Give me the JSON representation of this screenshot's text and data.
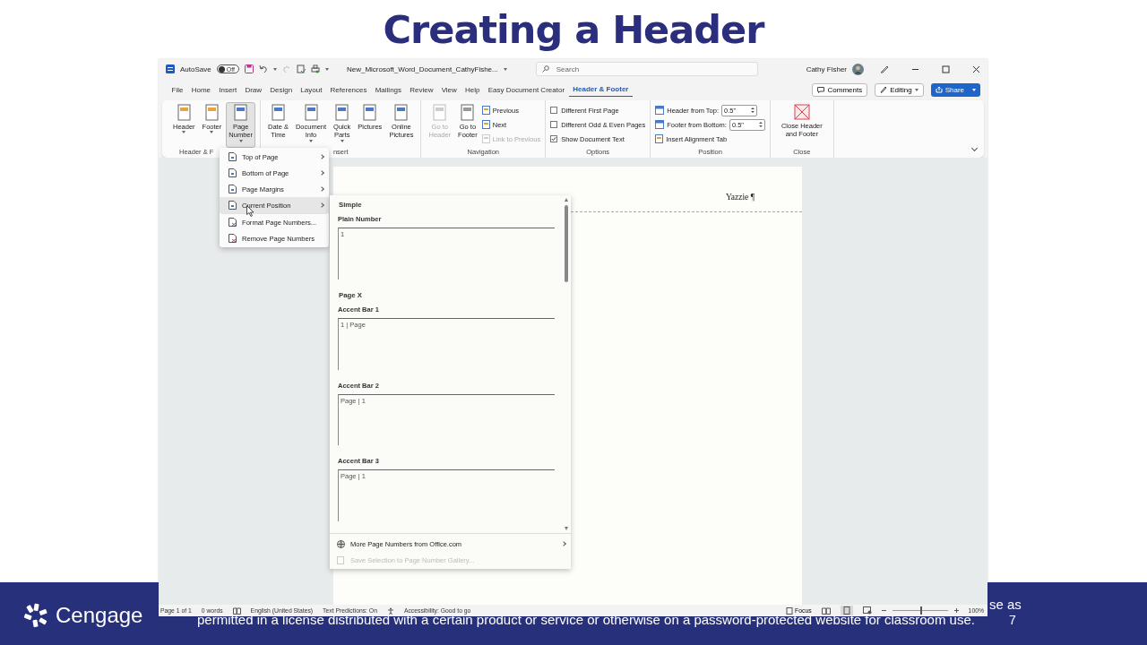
{
  "slide": {
    "title": "Creating a Header",
    "logo": "Cengage",
    "footer_line_1": "se as",
    "footer_line_2": "permitted in a license distributed with a certain product or service or otherwise on a password-protected website for classroom use.",
    "page_number": "7"
  },
  "window": {
    "autosave_label": "AutoSave",
    "autosave": {
      "label": "Off",
      "on": false
    },
    "filename": "New_Microsoft_Word_Document_CathyFishe...",
    "search": {
      "placeholder": "Search"
    },
    "user": "Cathy Fisher"
  },
  "tabs": [
    {
      "label": "File",
      "selected": false
    },
    {
      "label": "Home",
      "selected": false
    },
    {
      "label": "Insert",
      "selected": false
    },
    {
      "label": "Draw",
      "selected": false
    },
    {
      "label": "Design",
      "selected": false
    },
    {
      "label": "Layout",
      "selected": false
    },
    {
      "label": "References",
      "selected": false
    },
    {
      "label": "Mailings",
      "selected": false
    },
    {
      "label": "Review",
      "selected": false
    },
    {
      "label": "View",
      "selected": false
    },
    {
      "label": "Help",
      "selected": false
    },
    {
      "label": "Easy Document Creator",
      "selected": false
    },
    {
      "label": "Header & Footer",
      "selected": true
    }
  ],
  "actions": {
    "comments": "Comments",
    "editing": "Editing",
    "share": "Share"
  },
  "ribbon": [
    {
      "label": "Header & F",
      "items": [
        {
          "kind": "large",
          "label": "Header",
          "dropdown": true,
          "pressed": false,
          "disabled": false
        },
        {
          "kind": "large",
          "label": "Footer",
          "dropdown": true,
          "pressed": false,
          "disabled": false
        },
        {
          "kind": "large",
          "label": "Page\nNumber",
          "dropdown": true,
          "pressed": true,
          "disabled": false
        }
      ]
    },
    {
      "label": "nsert",
      "items": [
        {
          "kind": "large",
          "label": "Date &\nTime",
          "dropdown": false,
          "pressed": false,
          "disabled": false
        },
        {
          "kind": "large",
          "label": "Document\nInfo",
          "dropdown": true,
          "pressed": false,
          "disabled": false
        },
        {
          "kind": "large",
          "label": "Quick\nParts",
          "dropdown": true,
          "pressed": false,
          "disabled": false
        },
        {
          "kind": "large",
          "label": "Pictures",
          "dropdown": false,
          "pressed": false,
          "disabled": false
        },
        {
          "kind": "large",
          "label": "Online\nPictures",
          "dropdown": false,
          "pressed": false,
          "disabled": false
        }
      ]
    },
    {
      "label": "Navigation",
      "items": [
        {
          "kind": "large",
          "label": "Go to\nHeader",
          "dropdown": false,
          "pressed": false,
          "disabled": true
        },
        {
          "kind": "large",
          "label": "Go to\nFooter",
          "dropdown": false,
          "pressed": false,
          "disabled": false
        },
        {
          "kind": "stack",
          "children": [
            {
              "kind": "small",
              "label": "Previous",
              "disabled": false
            },
            {
              "kind": "small",
              "label": "Next",
              "disabled": false
            },
            {
              "kind": "small",
              "label": "Link to Previous",
              "disabled": true
            }
          ]
        }
      ]
    },
    {
      "label": "Options",
      "items": [
        {
          "kind": "stack",
          "children": [
            {
              "kind": "checkbox",
              "label": "Different First Page",
              "checked": false
            },
            {
              "kind": "checkbox",
              "label": "Different Odd & Even Pages",
              "checked": false
            },
            {
              "kind": "checkbox",
              "label": "Show Document Text",
              "checked": true
            }
          ]
        }
      ]
    },
    {
      "label": "Position",
      "items": [
        {
          "kind": "stack",
          "children": [
            {
              "kind": "spinner",
              "label": "Header from Top:",
              "value": "0.5\""
            },
            {
              "kind": "spinner",
              "label": "Footer from Bottom:",
              "value": "0.5\""
            },
            {
              "kind": "small",
              "label": "Insert Alignment Tab",
              "disabled": false
            }
          ]
        }
      ]
    },
    {
      "label": "Close",
      "items": [
        {
          "kind": "close",
          "label": "Close Header\nand Footer"
        }
      ]
    }
  ],
  "document": {
    "header_text": "Yazzie ¶"
  },
  "menu": [
    {
      "label": "Top of Page",
      "kind": "submenu",
      "selected": false
    },
    {
      "label": "Bottom of Page",
      "kind": "submenu",
      "selected": false
    },
    {
      "label": "Page Margins",
      "kind": "submenu",
      "selected": false
    },
    {
      "label": "Current Position",
      "kind": "submenu",
      "selected": true
    },
    {
      "label": "Format Page Numbers...",
      "kind": "command",
      "selected": false
    },
    {
      "label": "Remove Page Numbers",
      "kind": "command",
      "selected": false
    }
  ],
  "gallery": {
    "sections": [
      {
        "heading": "Simple",
        "items": [
          {
            "label": "Plain Number",
            "preview": "1"
          }
        ]
      },
      {
        "heading": "Page X",
        "items": [
          {
            "label": "Accent Bar 1",
            "preview": "1 | Page"
          },
          {
            "label": "Accent Bar 2",
            "preview": "Page | 1"
          },
          {
            "label": "Accent Bar 3",
            "preview": "Page | 1"
          }
        ]
      }
    ],
    "footer": [
      {
        "label": "More Page Numbers from Office.com",
        "disabled": false
      },
      {
        "label": "Save Selection to Page Number Gallery...",
        "disabled": true
      }
    ]
  },
  "status_bar": {
    "left": [
      "Page 1 of 1",
      "0 words",
      "English (United States)",
      "Text Predictions: On",
      "Accessibility: Good to go"
    ],
    "focus": "Focus",
    "zoom": "100%"
  }
}
